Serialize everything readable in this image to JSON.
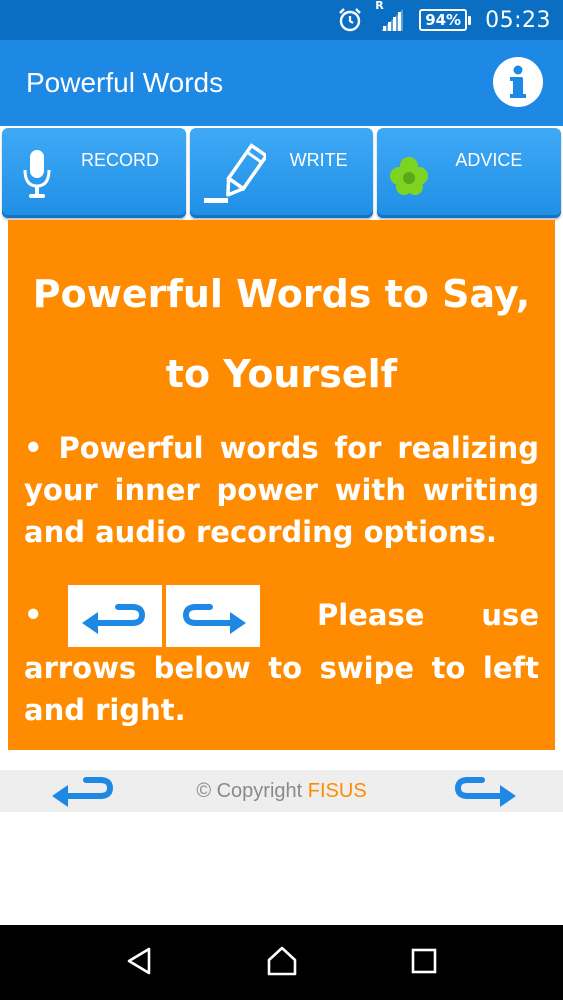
{
  "status_bar": {
    "roaming_label": "R",
    "battery": "94%",
    "time": "05:23",
    "icons": [
      "alarm-icon",
      "signal-icon",
      "battery-icon"
    ]
  },
  "app_bar": {
    "title": "Powerful Words",
    "info_icon": "info-icon"
  },
  "tabs": [
    {
      "label": "RECORD",
      "icon": "microphone-icon"
    },
    {
      "label": "WRITE",
      "icon": "pencil-icon"
    },
    {
      "label": "ADVICE",
      "icon": "clover-icon"
    }
  ],
  "content": {
    "heading_line1": "Powerful Words to Say,",
    "heading_line2": "to Yourself",
    "bullet1": "•  Powerful words for realizing your inner power with writing and audio recording options.",
    "bullet2_dot": "•",
    "bullet2_text": " Please use arrows below to swipe to left and right."
  },
  "footer": {
    "copyright_prefix": "© Copyright ",
    "brand": "FISUS",
    "left_arrow": "arrow-left-icon",
    "right_arrow": "arrow-right-icon"
  },
  "nav_bar": {
    "icons": [
      "back-icon",
      "home-icon",
      "recents-icon"
    ]
  },
  "colors": {
    "status_bar": "#0a6fc2",
    "app_bar": "#1e88e5",
    "tab": "#2196f3",
    "content": "#ff8c00",
    "arrow": "#1e88e5",
    "clover": "#7ed321"
  }
}
